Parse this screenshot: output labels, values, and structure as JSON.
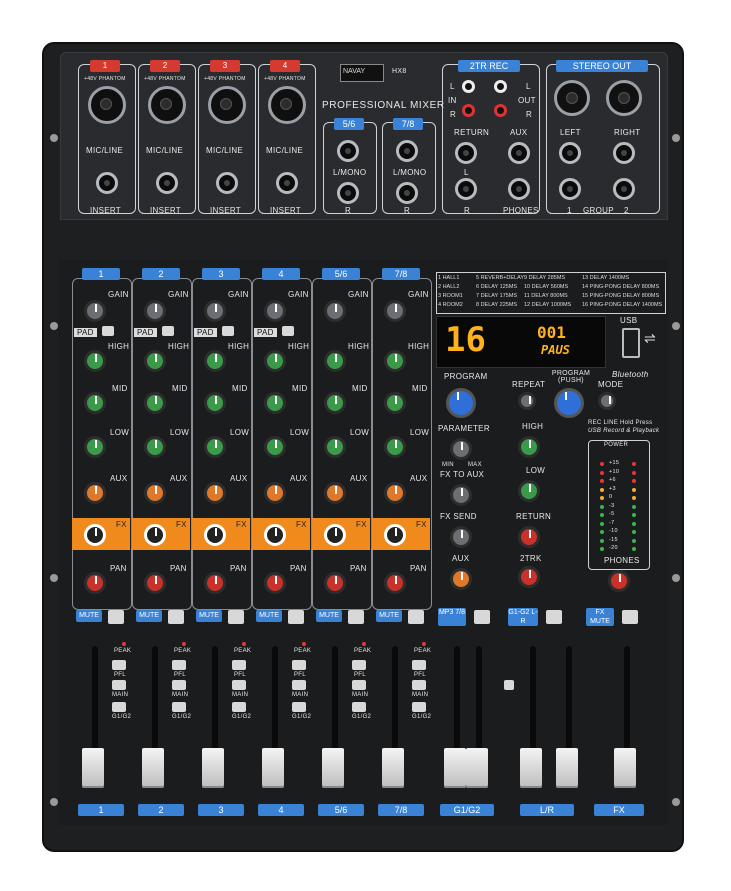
{
  "brand": "NAVAY",
  "model": "HX8",
  "product_name": "PROFESSIONAL MIXER",
  "rear_panel": {
    "channels": [
      "1",
      "2",
      "3",
      "4"
    ],
    "phantom_label": "+48V PHANTOM",
    "mic_line_label": "MIC/LINE",
    "insert_label": "INSERT",
    "stereo_inputs": [
      "5/6",
      "7/8"
    ],
    "l_mono_label": "L/MONO",
    "r_label": "R",
    "tr_rec_title": "2TR REC",
    "in_label": "IN",
    "out_label": "OUT",
    "l_label": "L",
    "return_label": "RETURN",
    "aux_label": "AUX",
    "phones_label": "PHONES",
    "stereo_out_title": "STEREO OUT",
    "left_label": "LEFT",
    "right_label": "RIGHT",
    "group_label": "GROUP",
    "group_1": "1",
    "group_2": "2"
  },
  "channel_strip": {
    "channels": [
      "1",
      "2",
      "3",
      "4",
      "5/6",
      "7/8"
    ],
    "gain": "GAIN",
    "pad": "PAD",
    "high": "HIGH",
    "mid": "MID",
    "low": "LOW",
    "aux": "AUX",
    "fx": "FX",
    "pan": "PAN",
    "mute": "MUTE",
    "peak": "PEAK",
    "pfl": "PFL",
    "main": "MAIN",
    "g1g2": "G1/G2"
  },
  "fx_table": [
    [
      "1 HALL1",
      "5 REVERB+DELAY",
      "9 DELAY 285MS",
      "13 DELAY 1400MS"
    ],
    [
      "2 HALL2",
      "6 DELAY 125MS",
      "10 DELAY 560MS",
      "14 PING-PONG DELAY 800MS"
    ],
    [
      "3 ROOM1",
      "7 DELAY 175MS",
      "11 DELAY 800MS",
      "15 PING-PONG DELAY 800MS"
    ],
    [
      "4 ROOM2",
      "8 DELAY 225MS",
      "12 DELAY 1000MS",
      "16 PING-PONG DELAY 1400MS"
    ]
  ],
  "display": {
    "program_number": "16",
    "track_number": "001",
    "status": "PAUS",
    "usb_label": "USB"
  },
  "fx_section": {
    "program": "PROGRAM",
    "parameter": "PARAMETER",
    "min": "MIN",
    "max": "MAX",
    "fx_to_aux": "FX TO AUX",
    "fx_send": "FX SEND",
    "aux": "AUX",
    "repeat": "REPEAT",
    "program_push": "PROGRAM (PUSH)",
    "mode": "MODE",
    "bluetooth": "Bluetooth",
    "rec_label": "REC LINE Hold Press",
    "usb_record": "USB Record & Playback",
    "high": "HIGH",
    "low": "LOW",
    "return": "RETURN",
    "tr2": "2TRK",
    "phones": "PHONES",
    "power": "POWER",
    "mp3_btn": "MP3 7/8",
    "g1g2_lr": "G1-G2 L-R",
    "fx_mute": "FX MUTE"
  },
  "meter_scale": [
    "+15",
    "+10",
    "+6",
    "+3",
    "0",
    "-3",
    "-5",
    "-7",
    "-10",
    "-15",
    "-20"
  ],
  "fader_labels": {
    "channels": [
      "1",
      "2",
      "3",
      "4",
      "5/6",
      "7/8"
    ],
    "groups": "G1/G2",
    "lr": "L/R",
    "fx": "FX"
  }
}
